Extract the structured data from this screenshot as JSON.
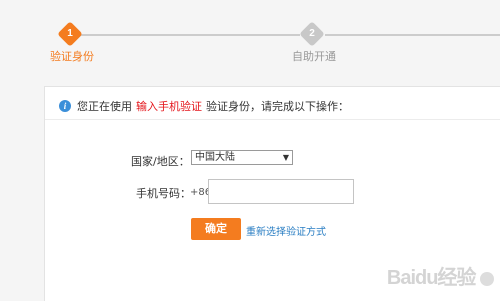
{
  "stepper": {
    "steps": [
      {
        "number": "1",
        "label": "验证身份",
        "active": true
      },
      {
        "number": "2",
        "label": "自助开通",
        "active": false
      }
    ],
    "active_color": "#f47c1f",
    "inactive_color": "#c8c8c8"
  },
  "notice": {
    "prefix": "您正在使用",
    "highlight": "输入手机验证",
    "suffix": "验证身份，请完成以下操作：",
    "icon": "info-icon",
    "highlight_color": "#e4151b"
  },
  "form": {
    "region_label": "国家/地区：",
    "region_value": "中国大陆",
    "phone_label": "手机号码：",
    "phone_prefix": "+86",
    "phone_value": "",
    "confirm_label": "确定",
    "alt_link": "重新选择验证方式"
  },
  "watermark": {
    "text": "Baidu经验"
  }
}
